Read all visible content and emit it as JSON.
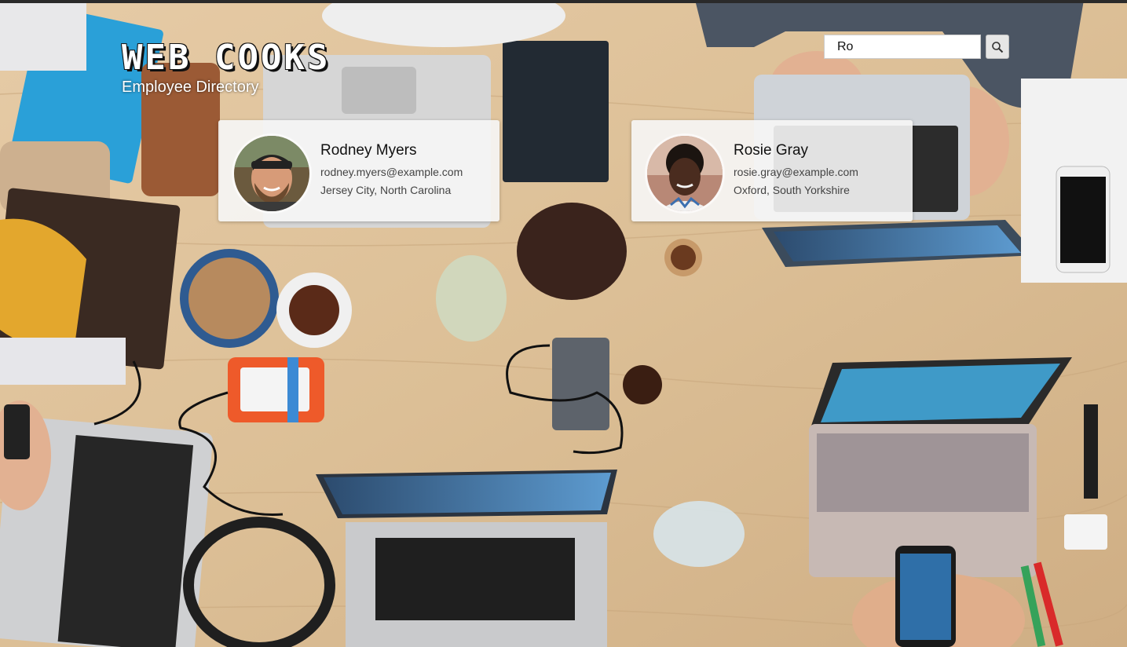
{
  "brand": {
    "title": "WEB COOKS",
    "subtitle": "Employee Directory"
  },
  "search": {
    "value": "Ro",
    "clear_icon": "close-icon",
    "button_icon": "search-icon",
    "accent_color": "#1b57a8"
  },
  "employees": [
    {
      "name": "Rodney Myers",
      "email": "rodney.myers@example.com",
      "location": "Jersey City, North Carolina"
    },
    {
      "name": "Rosie Gray",
      "email": "rosie.gray@example.com",
      "location": "Oxford, South Yorkshire"
    }
  ]
}
